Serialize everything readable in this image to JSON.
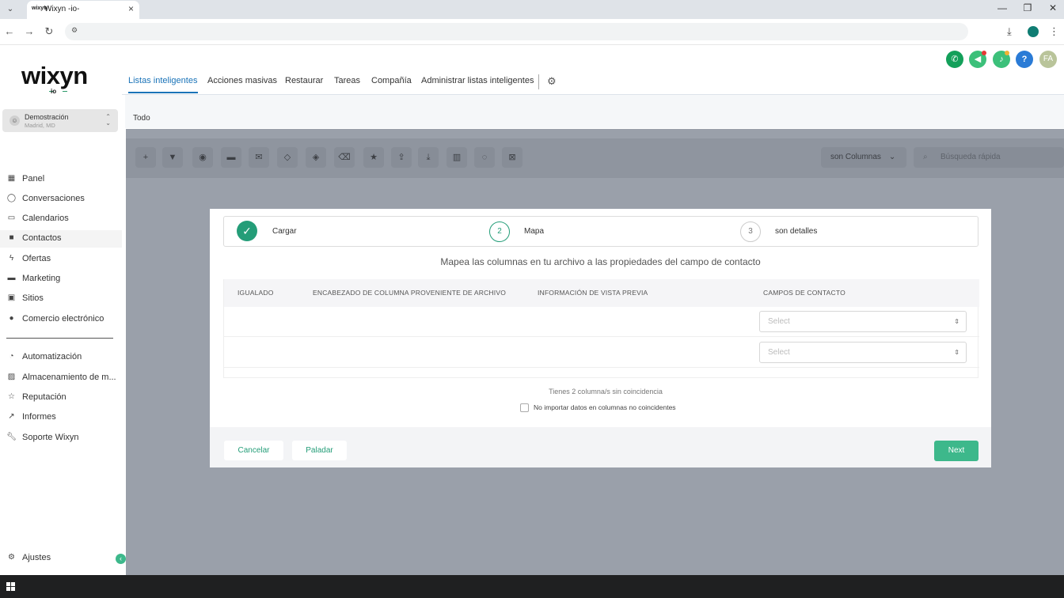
{
  "browser": {
    "tab_title": "Wixyn -io-",
    "tab_favicon": "wixyn",
    "icons": [
      "tab-menu-icon",
      "close-icon",
      "minimize-icon",
      "restore-icon",
      "back-icon",
      "forward-icon",
      "reload-icon",
      "site-settings-icon",
      "download-icon",
      "profile-icon",
      "more-icon"
    ]
  },
  "sidebar": {
    "logo_text": "wixyn",
    "logo_sub": "io",
    "account": {
      "name": "Demostración",
      "location": "Madrid, MD"
    },
    "items": [
      {
        "label": "Panel",
        "icon": "grid-icon"
      },
      {
        "label": "Conversaciones",
        "icon": "chat-icon"
      },
      {
        "label": "Calendarios",
        "icon": "calendar-icon"
      },
      {
        "label": "Contactos",
        "icon": "contacts-icon"
      },
      {
        "label": "Ofertas",
        "icon": "bolt-icon"
      },
      {
        "label": "Marketing",
        "icon": "ad-icon"
      },
      {
        "label": "Sitios",
        "icon": "site-icon"
      },
      {
        "label": "Comercio electrónico",
        "icon": "ecommerce-icon"
      }
    ],
    "items2": [
      {
        "label": "Automatización",
        "icon": "automation-icon"
      },
      {
        "label": "Almacenamiento de m...",
        "icon": "media-icon"
      },
      {
        "label": "Reputación",
        "icon": "star-icon"
      },
      {
        "label": "Informes",
        "icon": "chart-icon"
      },
      {
        "label": "Soporte Wixyn",
        "icon": "wrench-icon"
      }
    ],
    "settings_label": "Ajustes",
    "active_item": "Contactos"
  },
  "topnav": {
    "tabs": [
      "Listas inteligentes",
      "Acciones masivas",
      "Restaurar",
      "Tareas",
      "Compañía",
      "Administrar listas inteligentes"
    ],
    "active_tab": "Listas inteligentes",
    "avatar_initials": "FA",
    "help_label": "?"
  },
  "subtabs": {
    "current": "Todo"
  },
  "toolbar": {
    "columns_label": "son Columnas",
    "search_placeholder": "Búsqueda rápida"
  },
  "modal": {
    "steps": [
      {
        "number": "1",
        "label": "Cargar",
        "status": "done"
      },
      {
        "number": "2",
        "label": "Mapa",
        "status": "current"
      },
      {
        "number": "3",
        "label": "son detalles",
        "status": "pending"
      }
    ],
    "heading": "Mapea las columnas en tu archivo a las propiedades del campo de contacto",
    "table_headers": [
      "IGUALADO",
      "ENCABEZADO DE COLUMNA PROVENIENTE DE ARCHIVO",
      "INFORMACIÓN DE VISTA PREVIA",
      "CAMPOS DE CONTACTO"
    ],
    "rows": [
      {
        "select_placeholder": "Select"
      },
      {
        "select_placeholder": "Select"
      }
    ],
    "unmatched_text": "Tienes 2 columna/s sin coincidencia",
    "checkbox_label": "No importar datos en columnas no coincidentes",
    "cancel_label": "Cancelar",
    "back_label": "Paladar",
    "next_label": "Next"
  },
  "colors": {
    "accent_green": "#3db88b",
    "primary_blue": "#1a73b8",
    "phone_green": "#13a05a",
    "bell_green": "#3cc07a",
    "help_blue": "#2a7bd6",
    "avatar_bg": "#b9c49a"
  }
}
